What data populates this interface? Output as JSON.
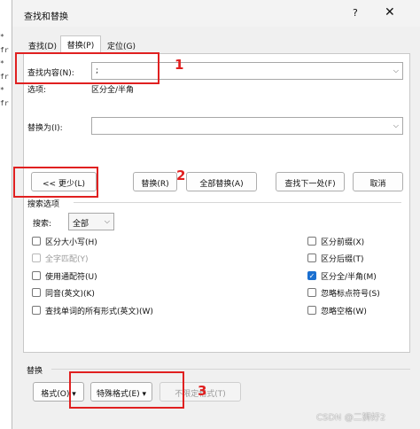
{
  "background_text": [
    "* fr",
    "* fr",
    "* fr"
  ],
  "window": {
    "title": "查找和替换",
    "help_glyph": "?",
    "close_glyph": "✕"
  },
  "tabs": [
    {
      "label": "查找(D)",
      "selected": false
    },
    {
      "label": "替换(P)",
      "selected": true
    },
    {
      "label": "定位(G)",
      "selected": false
    }
  ],
  "find": {
    "label": "查找内容(N):",
    "value": ";",
    "options_label": "选项:",
    "options_value": "区分全/半角"
  },
  "replace": {
    "label": "替换为(I):",
    "value": ""
  },
  "buttons": {
    "less": "<< 更少(L)",
    "replace": "替换(R)",
    "replace_all": "全部替换(A)",
    "find_next": "查找下一处(F)",
    "cancel": "取消"
  },
  "search_options": {
    "section_label": "搜索选项",
    "search_label": "搜索:",
    "search_value": "全部",
    "left": [
      {
        "label": "区分大小写(H)",
        "checked": false,
        "disabled": false
      },
      {
        "label": "全字匹配(Y)",
        "checked": false,
        "disabled": true
      },
      {
        "label": "使用通配符(U)",
        "checked": false,
        "disabled": false
      },
      {
        "label": "同音(英文)(K)",
        "checked": false,
        "disabled": false
      },
      {
        "label": "查找单词的所有形式(英文)(W)",
        "checked": false,
        "disabled": false
      }
    ],
    "right": [
      {
        "label": "区分前缀(X)",
        "checked": false
      },
      {
        "label": "区分后缀(T)",
        "checked": false
      },
      {
        "label": "区分全/半角(M)",
        "checked": true
      },
      {
        "label": "忽略标点符号(S)",
        "checked": false
      },
      {
        "label": "忽略空格(W)",
        "checked": false
      }
    ]
  },
  "replace_section": {
    "label": "替换",
    "format": "格式(O) ▾",
    "special": "特殊格式(E) ▾",
    "no_format": "不限定格式(T)"
  },
  "annotations": [
    "1",
    "2",
    "3"
  ],
  "watermark": "CSDN @二狮好2",
  "colors": {
    "annotation_red": "#e02020",
    "checkbox_blue": "#1a6fd0"
  }
}
